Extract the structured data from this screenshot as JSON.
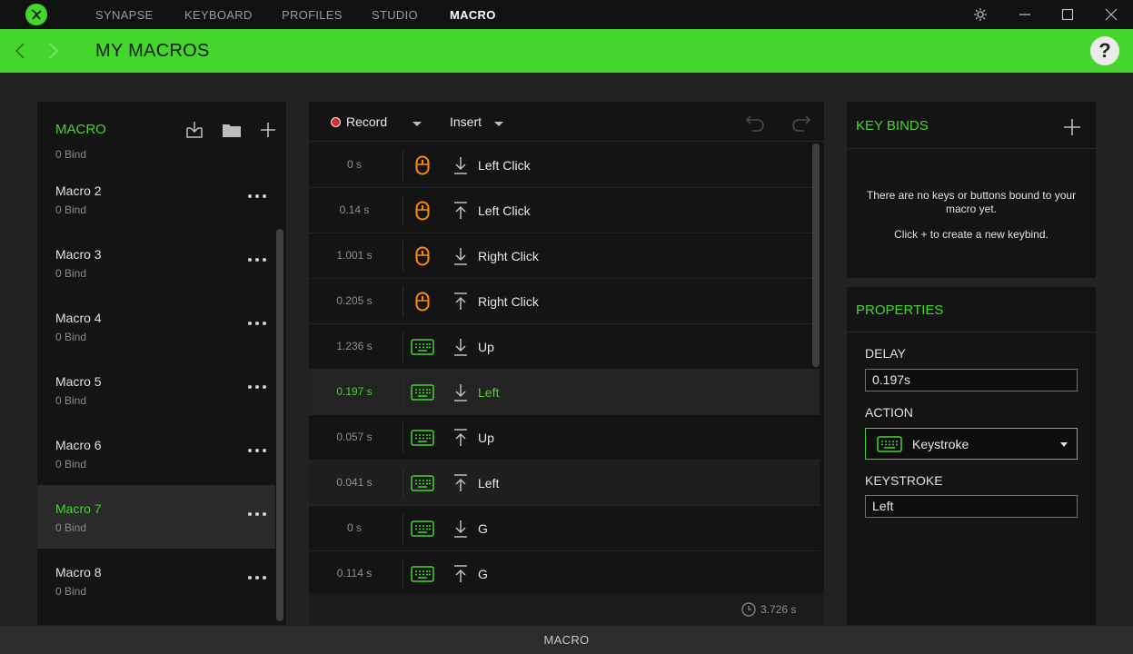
{
  "nav": {
    "tabs": [
      {
        "label": "SYNAPSE",
        "active": false
      },
      {
        "label": "KEYBOARD",
        "active": false
      },
      {
        "label": "PROFILES",
        "active": false
      },
      {
        "label": "STUDIO",
        "active": false
      },
      {
        "label": "MACRO",
        "active": true
      }
    ]
  },
  "header": {
    "title": "MY MACROS",
    "help_label": "?"
  },
  "colors": {
    "accent": "#44d62c",
    "background": "#222222",
    "panel": "#141414",
    "record": "#d9302c",
    "mouse_icon": "#ff8a00"
  },
  "macro_panel": {
    "heading": "MACRO",
    "partial_item_bind": "0 Bind",
    "items": [
      {
        "name": "Macro 2",
        "bind": "0 Bind",
        "selected": false
      },
      {
        "name": "Macro 3",
        "bind": "0 Bind",
        "selected": false
      },
      {
        "name": "Macro 4",
        "bind": "0 Bind",
        "selected": false
      },
      {
        "name": "Macro 5",
        "bind": "0 Bind",
        "selected": false
      },
      {
        "name": "Macro 6",
        "bind": "0 Bind",
        "selected": false
      },
      {
        "name": "Macro 7",
        "bind": "0 Bind",
        "selected": true
      },
      {
        "name": "Macro 8",
        "bind": "0 Bind",
        "selected": false
      }
    ]
  },
  "editor": {
    "record_label": "Record",
    "insert_label": "Insert",
    "events": [
      {
        "delay": "0 s",
        "device": "mouse",
        "direction": "down",
        "name": "Left Click"
      },
      {
        "delay": "0.14 s",
        "device": "mouse",
        "direction": "up",
        "name": "Left Click"
      },
      {
        "delay": "1.001 s",
        "device": "mouse",
        "direction": "down",
        "name": "Right Click"
      },
      {
        "delay": "0.205 s",
        "device": "mouse",
        "direction": "up",
        "name": "Right Click"
      },
      {
        "delay": "1.236 s",
        "device": "keyboard",
        "direction": "down",
        "name": "Up"
      },
      {
        "delay": "0.197 s",
        "device": "keyboard",
        "direction": "down",
        "name": "Left",
        "selected": true
      },
      {
        "delay": "0.057 s",
        "device": "keyboard",
        "direction": "up",
        "name": "Up"
      },
      {
        "delay": "0.041 s",
        "device": "keyboard",
        "direction": "up",
        "name": "Left"
      },
      {
        "delay": "0 s",
        "device": "keyboard",
        "direction": "down",
        "name": "G"
      },
      {
        "delay": "0.114 s",
        "device": "keyboard",
        "direction": "up",
        "name": "G"
      }
    ],
    "total_time": "3.726 s"
  },
  "keybinds": {
    "title": "KEY BINDS",
    "empty_message": "There are no keys or buttons bound to your macro yet.",
    "hint": "Click + to create a new keybind."
  },
  "properties": {
    "title": "PROPERTIES",
    "delay_label": "DELAY",
    "delay_value": "0.197s",
    "action_label": "ACTION",
    "action_value": "Keystroke",
    "keystroke_label": "KEYSTROKE",
    "keystroke_value": "Left"
  },
  "footer": {
    "device_label": "MACRO"
  }
}
